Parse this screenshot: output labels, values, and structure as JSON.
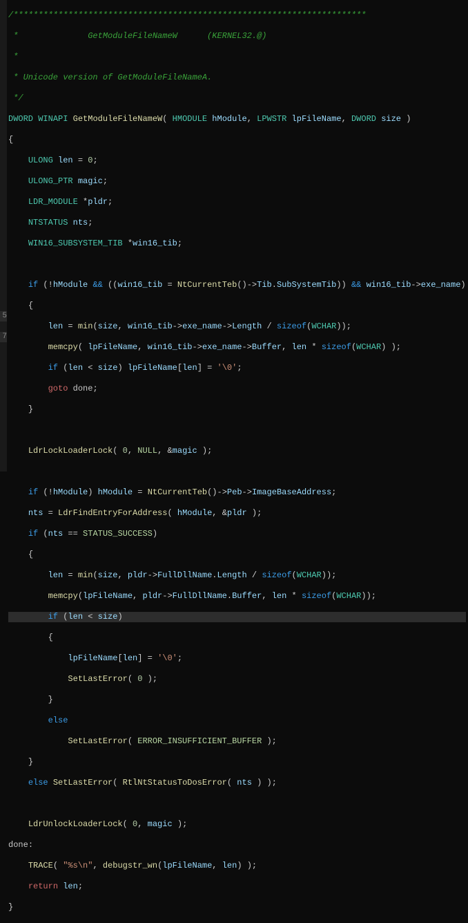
{
  "gutter": {
    "n1": "5",
    "n2": "7"
  },
  "code": {
    "l1": "/***********************************************************************",
    "l2_a": " *              ",
    "l2_b": "GetModuleFileNameW",
    "l2_c": "      (KERNEL32.@)",
    "l3": " *",
    "l4": " * Unicode version of GetModuleFileNameA.",
    "l5": " */",
    "l6_a": "DWORD",
    "l6_b": "WINAPI",
    "l6_c": "GetModuleFileNameW",
    "l6_d": "HMODULE",
    "l6_e": "hModule",
    "l6_f": "LPWSTR",
    "l6_g": "lpFileName",
    "l6_h": "DWORD",
    "l6_i": "size",
    "l8_a": "ULONG",
    "l8_b": "len",
    "l8_c": "0",
    "l9_a": "ULONG_PTR",
    "l9_b": "magic",
    "l10_a": "LDR_MODULE",
    "l10_b": "pldr",
    "l11_a": "NTSTATUS",
    "l11_b": "nts",
    "l12_a": "WIN16_SUBSYSTEM_TIB",
    "l12_b": "win16_tib",
    "l14_a": "if",
    "l14_b": "hModule",
    "l14_c": "win16_tib",
    "l14_d": "NtCurrentTeb",
    "l14_e": "Tib",
    "l14_f": "SubSystemTib",
    "l14_g": "win16_tib",
    "l14_h": "exe_name",
    "l16_a": "len",
    "l16_b": "min",
    "l16_c": "size",
    "l16_d": "win16_tib",
    "l16_e": "exe_name",
    "l16_f": "Length",
    "l16_g": "sizeof",
    "l16_h": "WCHAR",
    "l17_a": "memcpy",
    "l17_b": "lpFileName",
    "l17_c": "win16_tib",
    "l17_d": "exe_name",
    "l17_e": "Buffer",
    "l17_f": "len",
    "l17_g": "sizeof",
    "l17_h": "WCHAR",
    "l18_a": "if",
    "l18_b": "len",
    "l18_c": "size",
    "l18_d": "lpFileName",
    "l18_e": "len",
    "l18_f": "'\\0'",
    "l19_a": "goto",
    "l19_b": "done",
    "l22_a": "LdrLockLoaderLock",
    "l22_b": "0",
    "l22_c": "NULL",
    "l22_d": "magic",
    "l24_a": "if",
    "l24_b": "hModule",
    "l24_c": "hModule",
    "l24_d": "NtCurrentTeb",
    "l24_e": "Peb",
    "l24_f": "ImageBaseAddress",
    "l25_a": "nts",
    "l25_b": "LdrFindEntryForAddress",
    "l25_c": "hModule",
    "l25_d": "pldr",
    "l26_a": "if",
    "l26_b": "nts",
    "l26_c": "STATUS_SUCCESS",
    "l28_a": "len",
    "l28_b": "min",
    "l28_c": "size",
    "l28_d": "pldr",
    "l28_e": "FullDllName",
    "l28_f": "Length",
    "l28_g": "sizeof",
    "l28_h": "WCHAR",
    "l29_a": "memcpy",
    "l29_b": "lpFileName",
    "l29_c": "pldr",
    "l29_d": "FullDllName",
    "l29_e": "Buffer",
    "l29_f": "len",
    "l29_g": "sizeof",
    "l29_h": "WCHAR",
    "l30_a": "if",
    "l30_b": "len",
    "l30_c": "size",
    "l32_a": "lpFileName",
    "l32_b": "len",
    "l32_c": "'\\0'",
    "l33_a": "SetLastError",
    "l33_b": "0",
    "l35_a": "else",
    "l36_a": "SetLastError",
    "l36_b": "ERROR_INSUFFICIENT_BUFFER",
    "l38_a": "else",
    "l38_b": "SetLastError",
    "l38_c": "RtlNtStatusToDosError",
    "l38_d": "nts",
    "l40_a": "LdrUnlockLoaderLock",
    "l40_b": "0",
    "l40_c": "magic",
    "l41_a": "done",
    "l42_a": "TRACE",
    "l42_b": "\"%s\\n\"",
    "l42_c": "debugstr_wn",
    "l42_d": "lpFileName",
    "l42_e": "len",
    "l43_a": "return",
    "l43_b": "len",
    "brace_open": "{",
    "brace_close": "}"
  }
}
